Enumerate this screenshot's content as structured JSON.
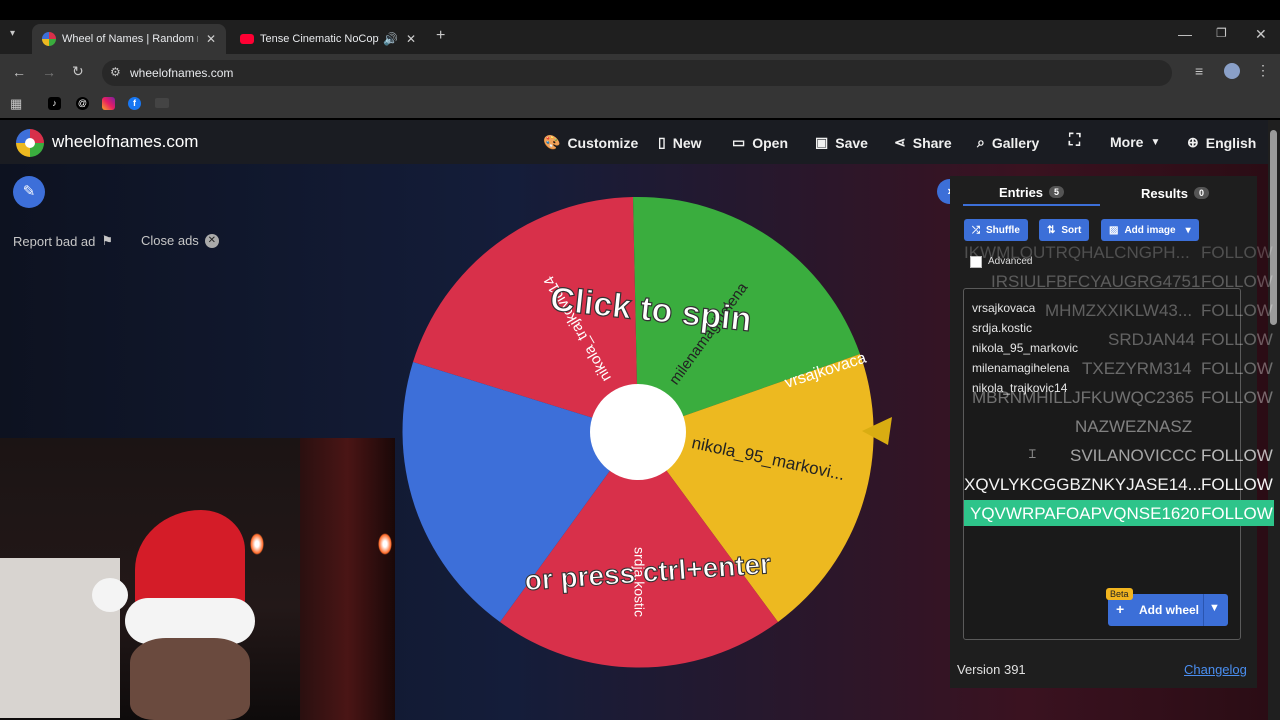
{
  "browser": {
    "tabs": [
      {
        "title": "Wheel of Names | Random nam",
        "active": true
      },
      {
        "title": "Tense Cinematic NoCopyrig",
        "active": false
      }
    ],
    "url": "wheelofnames.com"
  },
  "site": {
    "logo_text": "wheelofnames.com",
    "nav": {
      "customize": "Customize",
      "new": "New",
      "open": "Open",
      "save": "Save",
      "share": "Share",
      "gallery": "Gallery",
      "more": "More",
      "language": "English"
    },
    "report_bad_ad": "Report bad ad",
    "close_ads": "Close ads"
  },
  "wheel": {
    "click_to_spin": "Click to spin",
    "or_press": "or press ctrl+enter",
    "colors": {
      "red": "#d8304a",
      "green": "#3aad3e",
      "yellow": "#edb920",
      "blue": "#3d6fd9",
      "red2": "#d8304a"
    },
    "slices": [
      "nikola_trajkovic14",
      "milenamagihelena",
      "nikola_95_markovi...",
      "srdja.kostic",
      "vrsajkovaca"
    ]
  },
  "panel": {
    "tab_entries": "Entries",
    "entries_count": "5",
    "tab_results": "Results",
    "results_count": "0",
    "shuffle": "Shuffle",
    "sort": "Sort",
    "add_image": "Add image",
    "advanced": "Advanced",
    "entries": [
      "vrsajkovaca",
      "srdja.kostic",
      "nikola_95_markovic",
      "milenamagihelena",
      "nikola_trajkovic14"
    ],
    "beta": "Beta",
    "add_wheel": "Add wheel",
    "version": "Version 391",
    "changelog": "Changelog"
  },
  "overlay": {
    "rows": [
      {
        "name": "IKWMLQUTRQHALCNGPH...",
        "follow": "FOLLOW"
      },
      {
        "name": "IRSIULFBFCYAUGRG4751",
        "follow": "FOLLOW"
      },
      {
        "name": "MHMZXXIKLW43...",
        "follow": "FOLLOW"
      },
      {
        "name": "SRDJAN44",
        "follow": "FOLLOW"
      },
      {
        "name": "TXEZYRM314",
        "follow": "FOLLOW"
      },
      {
        "name": "MBRNMHILLJFKUWQC2365",
        "follow": "FOLLOW"
      },
      {
        "name": "NAZWEZNASZ",
        "follow": ""
      },
      {
        "name": "SVILANOVICCC",
        "follow": "FOLLOW"
      },
      {
        "name": "XQVLYKCGGBZNKYJASE14...",
        "follow": "FOLLOW"
      },
      {
        "name": "YQVWRPAFOAPVQNSE1620",
        "follow": "FOLLOW"
      }
    ],
    "highlight_color": "#2ec48a"
  }
}
